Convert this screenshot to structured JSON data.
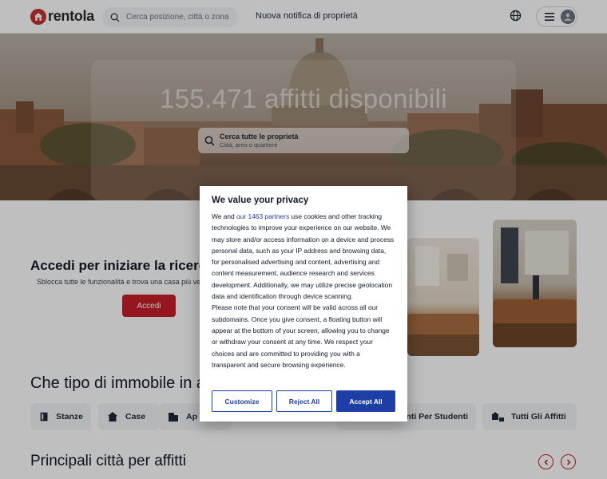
{
  "header": {
    "brand": "rentola",
    "search_placeholder": "Cerca posizione, città o zona",
    "notify_link": "Nuova notifica di proprietà"
  },
  "hero": {
    "title": "155.471 affitti disponibili",
    "search_label": "Cerca tutte le proprietà",
    "search_hint": "Città, area o quartiere"
  },
  "login": {
    "title": "Accedi per iniziare la ricerca de",
    "subtitle": "Sblocca tutte le funzionalità e trova una casa più ve",
    "button": "Accedi"
  },
  "property_types": {
    "title": "Che tipo di immobile in a",
    "chips": [
      {
        "label": "Stanze",
        "icon": "rooms-icon"
      },
      {
        "label": "Case",
        "icon": "house-icon"
      },
      {
        "label": "Ap",
        "icon": "apartment-icon"
      },
      {
        "label": "enti Per Studenti",
        "icon": "student-icon"
      },
      {
        "label": "Tutti Gli Affitti",
        "icon": "all-rentals-icon"
      }
    ]
  },
  "cities": {
    "title": "Principali città per affitti"
  },
  "consent": {
    "title": "We value your privacy",
    "text_before_link": "We and ",
    "link": "our 1463 partners",
    "text_after_link": " use cookies and other tracking technologies to improve your experience on our website. We may store and/or access information on a device and process personal data, such as your IP address and browsing data, for personalised advertising and content, advertising and content measurement, audience research and services development. Additionally, we may utilize precise geolocation data and identification through device scanning.",
    "text_2": "Please note that your consent will be valid across all our subdomains. Once you give consent, a floating button will appear at the bottom of your screen, allowing you to change or withdraw your consent at any time. We respect your choices and are committed to providing you with a transparent and secure browsing experience.",
    "buttons": {
      "customize": "Customize",
      "reject": "Reject All",
      "accept": "Accept All"
    }
  },
  "colors": {
    "brand_red": "#c81e2a",
    "consent_blue": "#1e3fa6"
  }
}
